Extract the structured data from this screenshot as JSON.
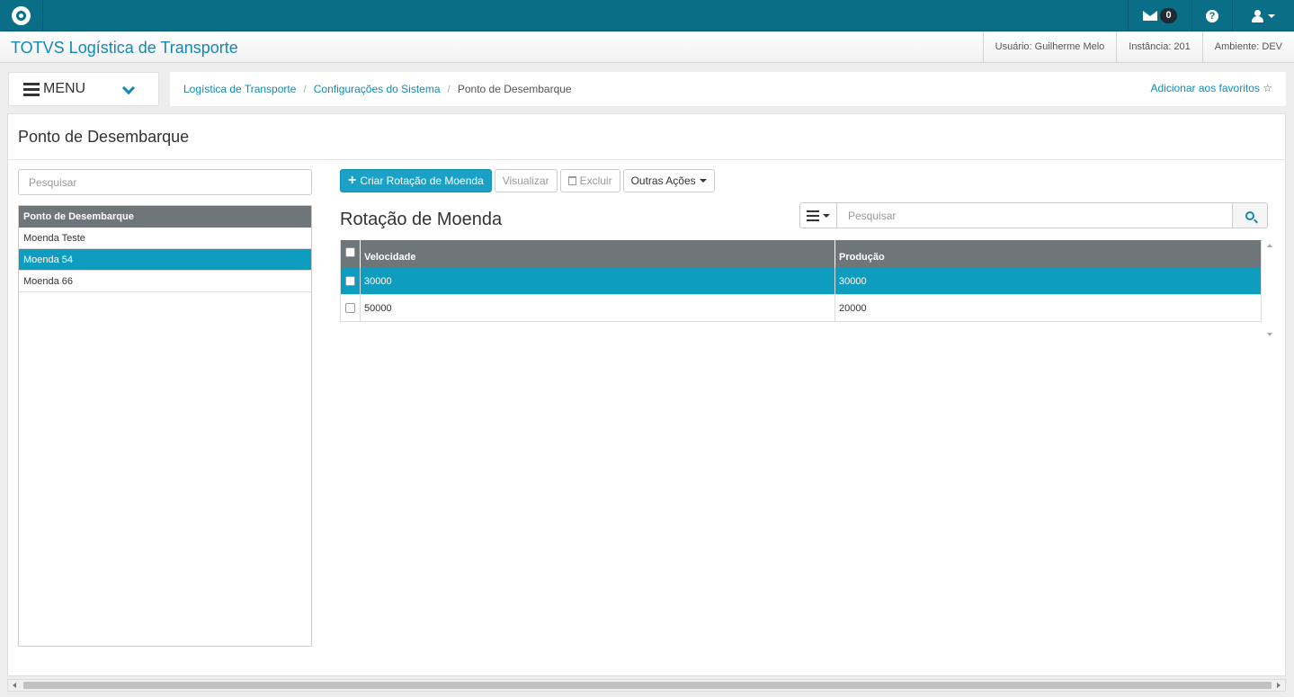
{
  "topbar": {
    "logo_icon": "totvs-logo-icon",
    "mail_count": "0",
    "mail_icon": "envelope-icon",
    "help_icon": "question-circle-icon",
    "user_icon": "user-icon"
  },
  "app": {
    "title": "TOTVS Logística de Transporte",
    "user_info": "Usuário: Guilherme Melo",
    "instance_info": "Instância: 201",
    "environment_info": "Ambiente: DEV"
  },
  "menu": {
    "label": "MENU"
  },
  "breadcrumb": {
    "items": [
      "Logística de Transporte",
      "Configurações do Sistema",
      "Ponto de Desembarque"
    ],
    "separator": "/",
    "favorite_label": "Adicionar aos favoritos",
    "favorite_icon": "star-outline-icon"
  },
  "page": {
    "title": "Ponto de Desembarque"
  },
  "left_panel": {
    "search_placeholder": "Pesquisar",
    "list_header": "Ponto de Desembarque",
    "items": [
      "Moenda Teste",
      "Moenda 54",
      "Moenda 66"
    ],
    "selected_index": 1
  },
  "toolbar": {
    "create_label": "Criar Rotação de Moenda",
    "view_label": "Visualizar",
    "delete_label": "Excluir",
    "more_label": "Outras Ações"
  },
  "grid": {
    "title": "Rotação de Moenda",
    "search_placeholder": "Pesquisar",
    "columns": [
      "Velocidade",
      "Produção"
    ],
    "rows": [
      {
        "velocidade": "30000",
        "producao": "30000",
        "selected": true
      },
      {
        "velocidade": "50000",
        "producao": "20000",
        "selected": false
      }
    ]
  },
  "colors": {
    "topbar": "#0a6e87",
    "accent": "#1289b5",
    "selection": "#0e9cbf",
    "header_gray": "#6e767a"
  }
}
